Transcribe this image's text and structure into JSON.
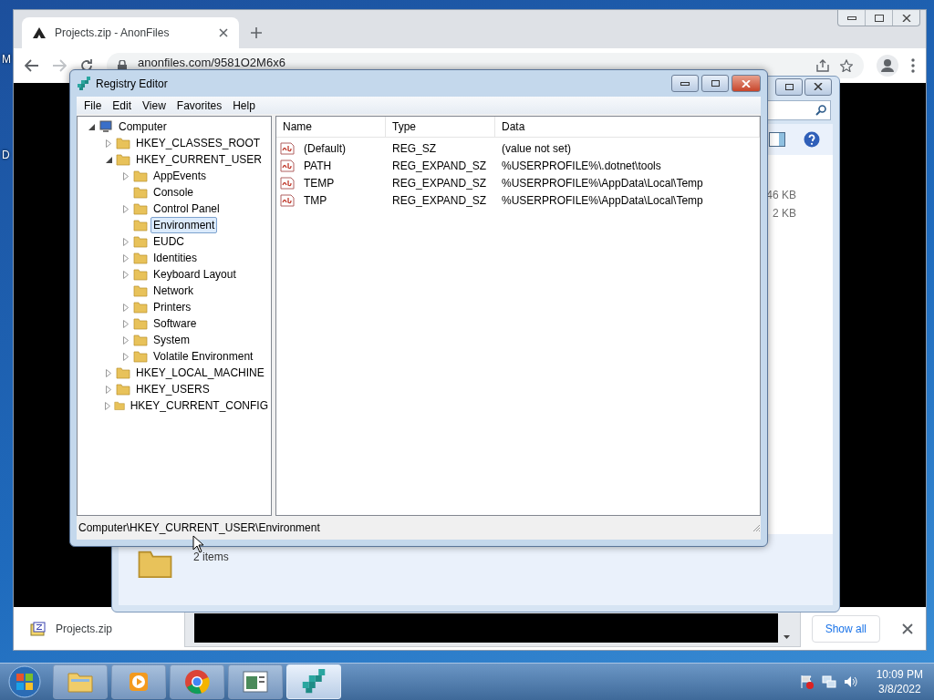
{
  "desktop": {
    "icon_labels": [
      "M",
      "D"
    ]
  },
  "browser": {
    "tabs": [
      {
        "title": "Projects.zip - AnonFiles",
        "selected": true
      }
    ],
    "address": "anonfiles.com/9581O2M6x6",
    "download": {
      "file": "Projects.zip",
      "show_all": "Show all"
    }
  },
  "explorer": {
    "sizes": [
      "46 KB",
      "2 KB"
    ],
    "status": "2 items"
  },
  "registry_editor": {
    "title": "Registry Editor",
    "menu": [
      "File",
      "Edit",
      "View",
      "Favorites",
      "Help"
    ],
    "tree": [
      {
        "label": "Computer",
        "expandable": true,
        "expanded": true,
        "selected": false,
        "children": [
          {
            "label": "HKEY_CLASSES_ROOT",
            "expandable": true,
            "expanded": false,
            "selected": false
          },
          {
            "label": "HKEY_CURRENT_USER",
            "expandable": true,
            "expanded": true,
            "selected": false,
            "children": [
              {
                "label": "AppEvents",
                "expandable": true,
                "expanded": false,
                "selected": false
              },
              {
                "label": "Console",
                "expandable": false,
                "selected": false
              },
              {
                "label": "Control Panel",
                "expandable": true,
                "expanded": false,
                "selected": false
              },
              {
                "label": "Environment",
                "expandable": false,
                "selected": true
              },
              {
                "label": "EUDC",
                "expandable": true,
                "expanded": false,
                "selected": false
              },
              {
                "label": "Identities",
                "expandable": true,
                "expanded": false,
                "selected": false
              },
              {
                "label": "Keyboard Layout",
                "expandable": true,
                "expanded": false,
                "selected": false
              },
              {
                "label": "Network",
                "expandable": false,
                "selected": false
              },
              {
                "label": "Printers",
                "expandable": true,
                "expanded": false,
                "selected": false
              },
              {
                "label": "Software",
                "expandable": true,
                "expanded": false,
                "selected": false
              },
              {
                "label": "System",
                "expandable": true,
                "expanded": false,
                "selected": false
              },
              {
                "label": "Volatile Environment",
                "expandable": true,
                "expanded": false,
                "selected": false
              }
            ]
          },
          {
            "label": "HKEY_LOCAL_MACHINE",
            "expandable": true,
            "expanded": false,
            "selected": false
          },
          {
            "label": "HKEY_USERS",
            "expandable": true,
            "expanded": false,
            "selected": false
          },
          {
            "label": "HKEY_CURRENT_CONFIG",
            "expandable": true,
            "expanded": false,
            "selected": false
          }
        ]
      }
    ],
    "columns": [
      "Name",
      "Type",
      "Data"
    ],
    "values": [
      {
        "name": "(Default)",
        "type": "REG_SZ",
        "data": "(value not set)"
      },
      {
        "name": "PATH",
        "type": "REG_EXPAND_SZ",
        "data": "%USERPROFILE%\\.dotnet\\tools"
      },
      {
        "name": "TEMP",
        "type": "REG_EXPAND_SZ",
        "data": "%USERPROFILE%\\AppData\\Local\\Temp"
      },
      {
        "name": "TMP",
        "type": "REG_EXPAND_SZ",
        "data": "%USERPROFILE%\\AppData\\Local\\Temp"
      }
    ],
    "status_bar": "Computer\\HKEY_CURRENT_USER\\Environment"
  },
  "taskbar": {
    "buttons": [
      {
        "kind": "explorer",
        "selected": false
      },
      {
        "kind": "media",
        "selected": false
      },
      {
        "kind": "chrome",
        "selected": false
      },
      {
        "kind": "document",
        "selected": false
      },
      {
        "kind": "regedit",
        "selected": true
      }
    ],
    "time": "10:09 PM",
    "date": "3/8/2022"
  }
}
